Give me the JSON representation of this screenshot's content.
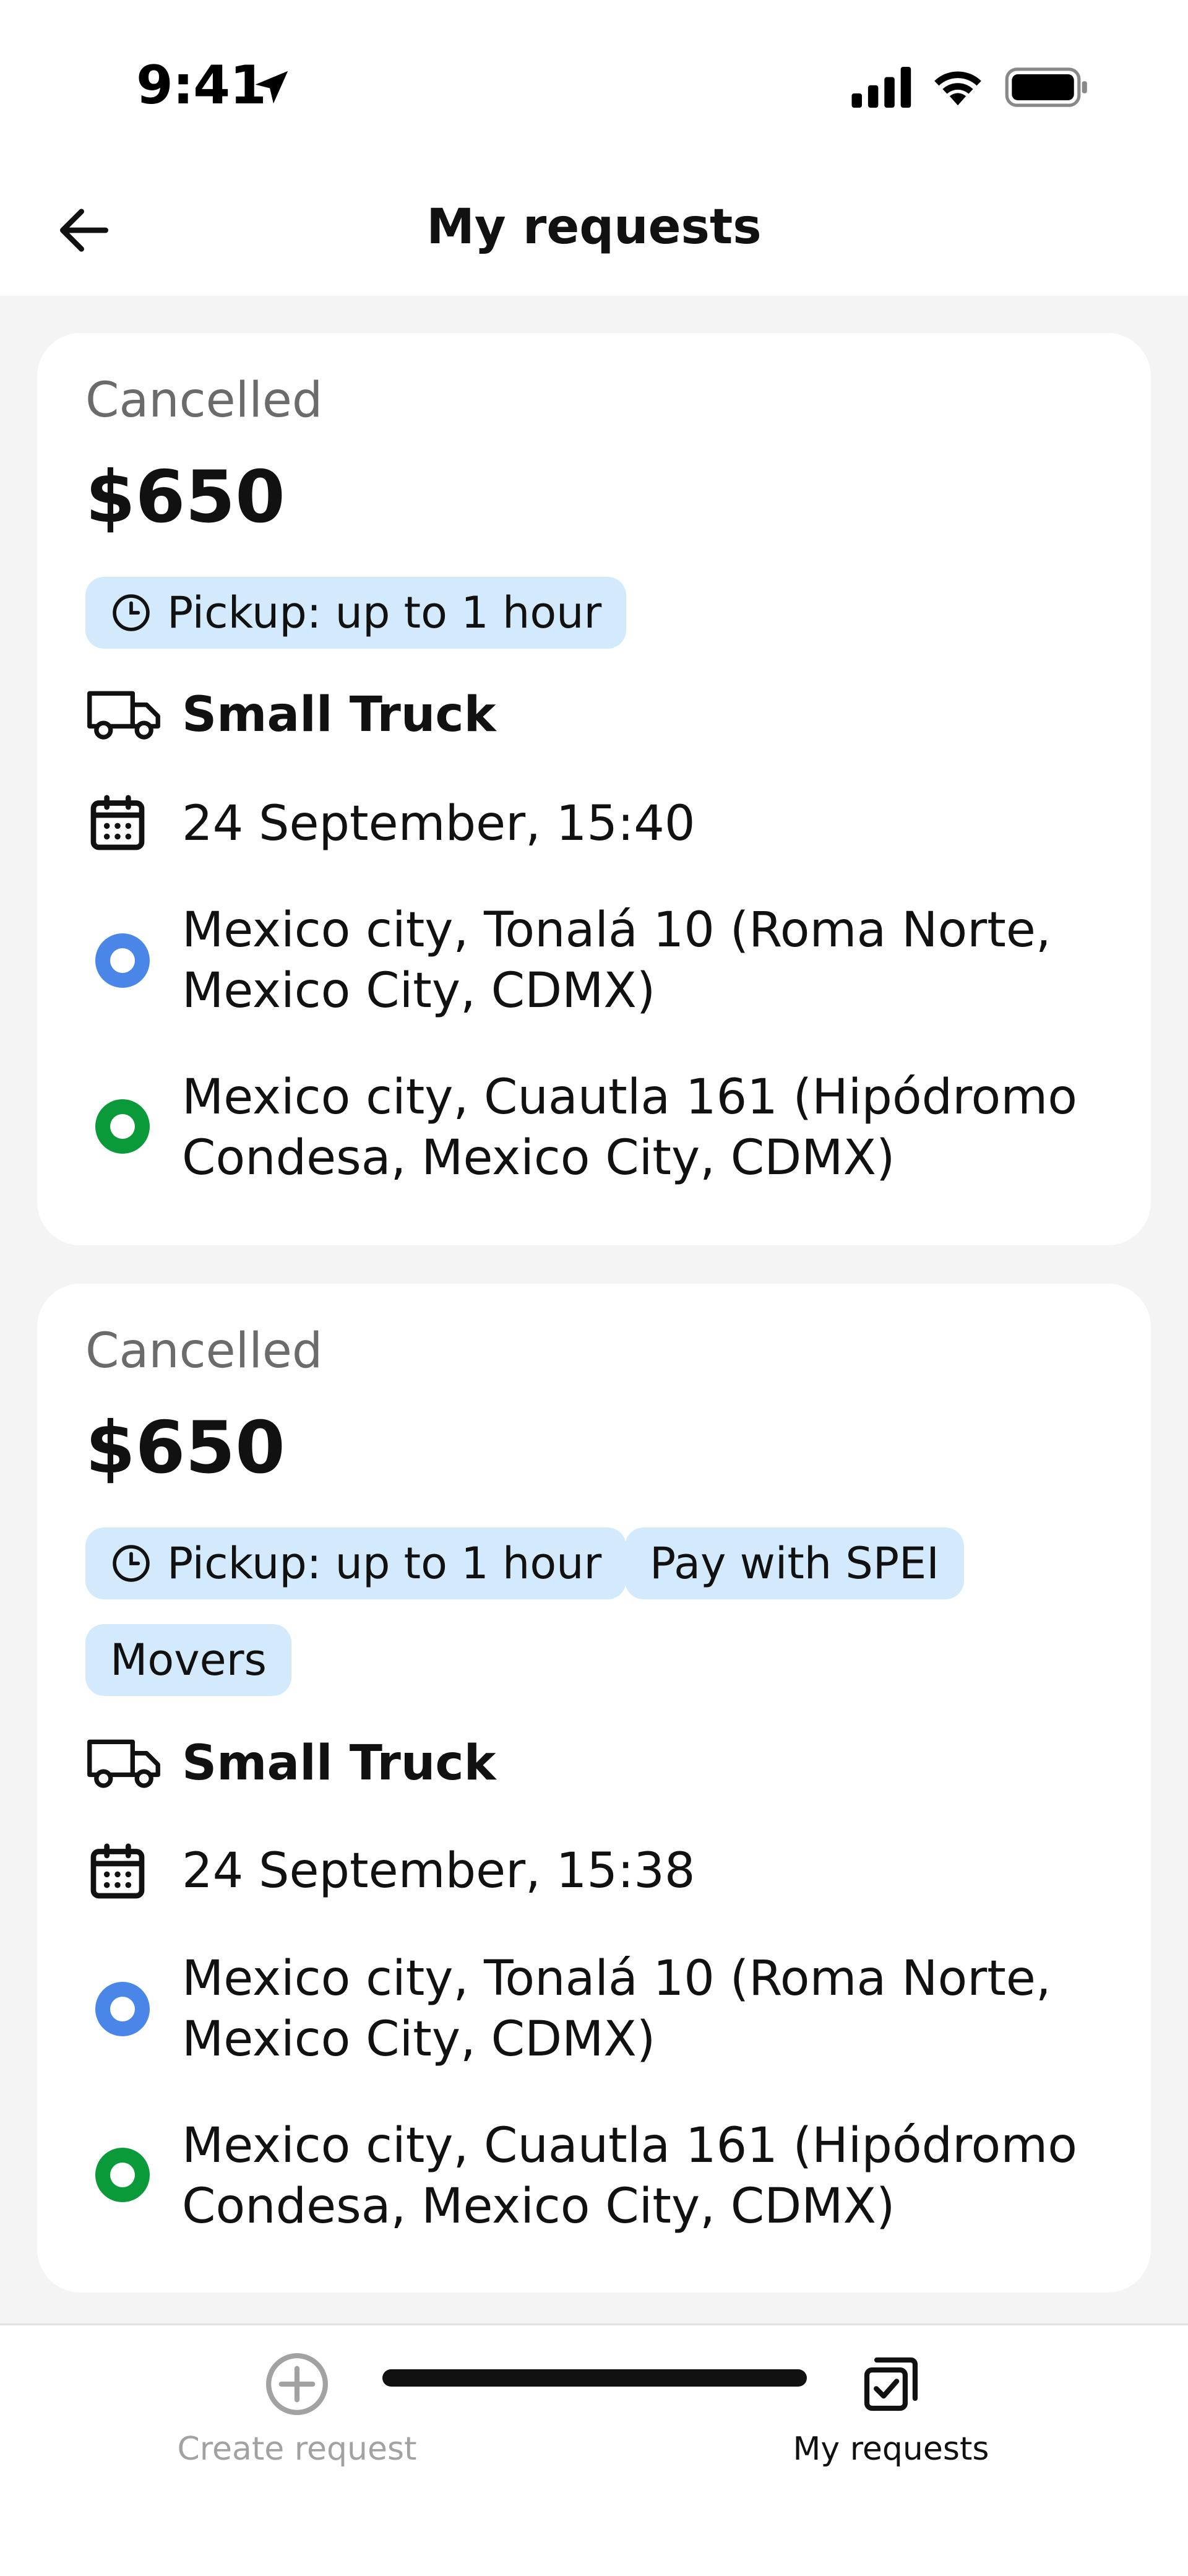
{
  "status_bar": {
    "time": "9:41",
    "icons": [
      "location-arrow-icon",
      "cellular-signal-icon",
      "wifi-icon",
      "battery-icon"
    ]
  },
  "nav": {
    "title": "My requests",
    "back_icon": "arrow-left-icon"
  },
  "requests": [
    {
      "status": "Cancelled",
      "price": "$650",
      "chips": [
        "Pickup: up to 1 hour"
      ],
      "vehicle": "Small Truck",
      "datetime": "24 September, 15:40",
      "pickup_address_line1": "Mexico city, Tonalá 10 (Roma Norte,",
      "pickup_address_line2": "Mexico City, CDMX)",
      "dropoff_address_line1": "Mexico city, Cuautla 161 (Hipódromo",
      "dropoff_address_line2": "Condesa, Mexico City, CDMX)"
    },
    {
      "status": "Cancelled",
      "price": "$650",
      "chips": [
        "Pickup: up to 1 hour",
        "Pay with SPEI",
        "Movers"
      ],
      "vehicle": "Small Truck",
      "datetime": "24 September, 15:38",
      "pickup_address_line1": "Mexico city, Tonalá 10 (Roma Norte,",
      "pickup_address_line2": "Mexico City, CDMX)",
      "dropoff_address_line1": "Mexico city, Cuautla 161 (Hipódromo",
      "dropoff_address_line2": "Condesa, Mexico City, CDMX)"
    }
  ],
  "tabs": [
    {
      "label": "Create request",
      "icon": "plus-circle-icon",
      "active": false
    },
    {
      "label": "My requests",
      "icon": "checked-copy-icon",
      "active": true
    }
  ],
  "colors": {
    "chip_bg": "#d3eafc",
    "pickup_dot": "#4a86e8",
    "dropoff_dot": "#0b9a3a",
    "muted_text": "#6b6b6b",
    "inactive_tab": "#a2a2a2"
  }
}
